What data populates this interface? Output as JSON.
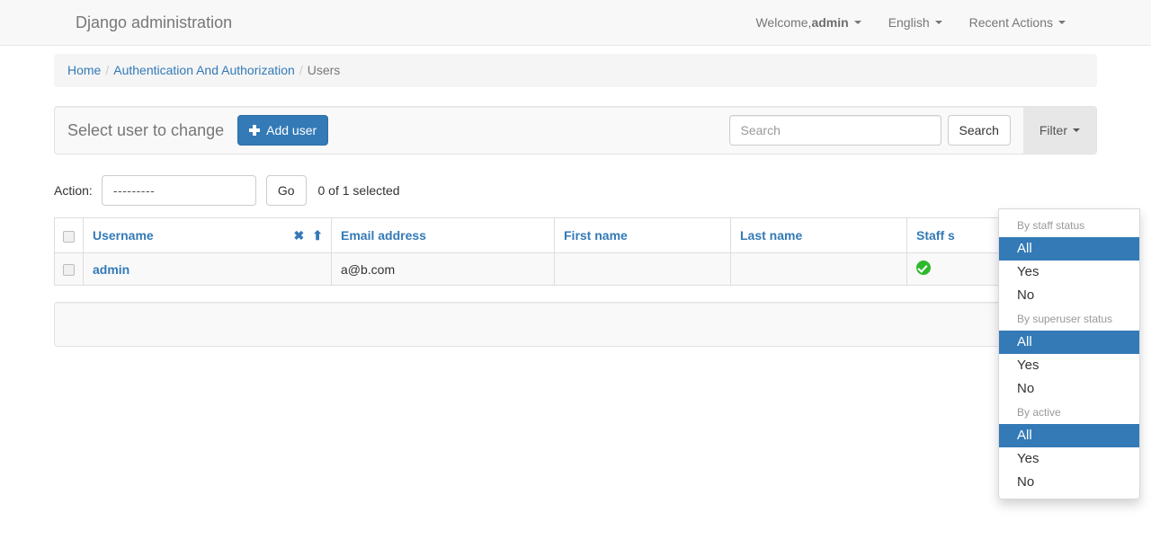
{
  "navbar": {
    "brand": "Django administration",
    "items": [
      {
        "prefix": "Welcome, ",
        "strong": "admin",
        "caret": true
      },
      {
        "prefix": "English",
        "strong": "",
        "caret": true
      },
      {
        "prefix": "Recent Actions",
        "strong": "",
        "caret": true
      }
    ]
  },
  "breadcrumb": {
    "home": "Home",
    "app": "Authentication And Authorization",
    "current": "Users",
    "separator": "/"
  },
  "toolbar": {
    "title": "Select user to change",
    "add_label": "Add user",
    "add_icon": "plus-icon",
    "search_placeholder": "Search",
    "search_value": "",
    "search_button": "Search",
    "filter_label": "Filter",
    "filter_caret_icon": "caret-down-icon"
  },
  "actions": {
    "label": "Action:",
    "selected_option": "---------",
    "options": [
      "---------"
    ],
    "go_label": "Go",
    "counter": "0 of 1 selected"
  },
  "table": {
    "select_all_name": "select-all-checkbox",
    "columns": [
      {
        "label": "Username",
        "sortable": true,
        "sort_state": "asc",
        "clear_icon": "✖",
        "arrow_icon": "⬆"
      },
      {
        "label": "Email address",
        "sortable": true,
        "sort_state": "none"
      },
      {
        "label": "First name",
        "sortable": true,
        "sort_state": "none"
      },
      {
        "label": "Last name",
        "sortable": true,
        "sort_state": "none"
      },
      {
        "label": "Staff s",
        "sortable": true,
        "sort_state": "none"
      }
    ],
    "rows": [
      {
        "username": "admin",
        "email": "a@b.com",
        "first_name": "",
        "last_name": "",
        "staff_status": "yes",
        "staff_status_icon": "green-check-icon"
      }
    ]
  },
  "filter_dropdown": {
    "groups": [
      {
        "header": "By staff status",
        "options": [
          {
            "label": "All",
            "selected": true
          },
          {
            "label": "Yes",
            "selected": false
          },
          {
            "label": "No",
            "selected": false
          }
        ]
      },
      {
        "header": "By superuser status",
        "options": [
          {
            "label": "All",
            "selected": true
          },
          {
            "label": "Yes",
            "selected": false
          },
          {
            "label": "No",
            "selected": false
          }
        ]
      },
      {
        "header": "By active",
        "options": [
          {
            "label": "All",
            "selected": true
          },
          {
            "label": "Yes",
            "selected": false
          },
          {
            "label": "No",
            "selected": false
          }
        ]
      }
    ]
  },
  "colors": {
    "primary": "#337ab7",
    "navbar_bg": "#f8f8f8",
    "panel_bg": "#f9f9f9",
    "muted_text": "#777777",
    "success_green": "#2eb82e",
    "filter_btn_bg": "#e7e7e7"
  }
}
